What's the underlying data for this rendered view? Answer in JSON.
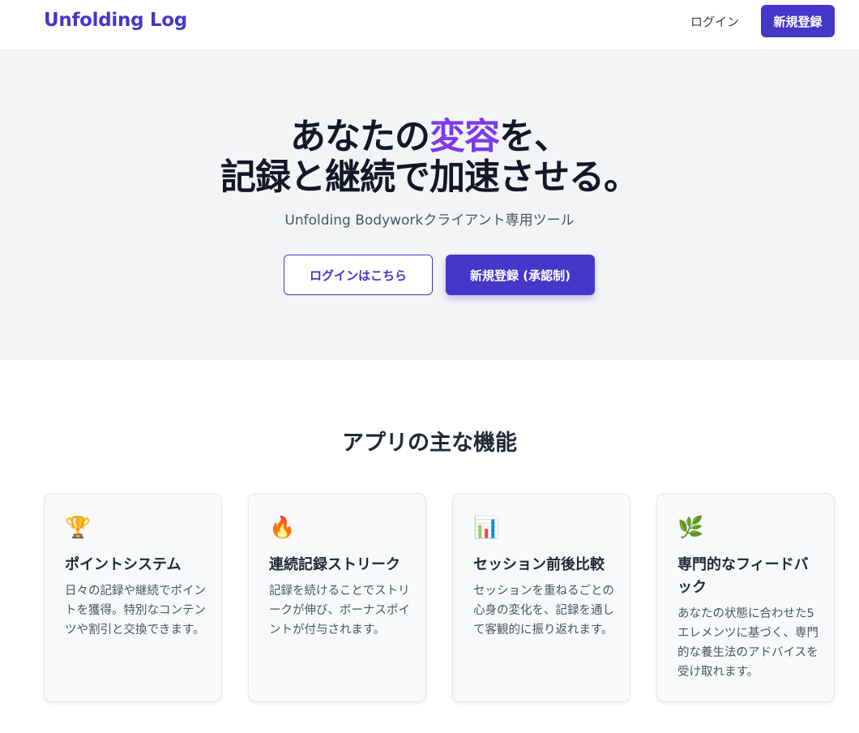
{
  "header": {
    "brand": "Unfolding Log",
    "login_label": "ログイン",
    "signup_label": "新規登録"
  },
  "hero": {
    "title_line1_pre": "あなたの",
    "title_line1_accent": "変容",
    "title_line1_post": "を、",
    "title_line2": "記録と継続で加速させる。",
    "subtitle": "Unfolding Bodyworkクライアント専用ツール",
    "login_button": "ログインはこちら",
    "signup_button": "新規登録 (承認制)"
  },
  "features": {
    "heading": "アプリの主な機能",
    "items": [
      {
        "icon": "trophy-icon",
        "glyph": "🏆",
        "title": "ポイントシステム",
        "description": "日々の記録や継続でポイントを獲得。特別なコンテンツや割引と交換できます。"
      },
      {
        "icon": "fire-icon",
        "glyph": "🔥",
        "title": "連続記録ストリーク",
        "description": "記録を続けることでストリークが伸び、ボーナスポイントが付与されます。"
      },
      {
        "icon": "bar-chart-icon",
        "glyph": "📊",
        "title": "セッション前後比較",
        "description": "セッションを重ねるごとの心身の変化を、記録を通して客観的に振り返れます。"
      },
      {
        "icon": "herb-icon",
        "glyph": "🌿",
        "title": "専門的なフィードバック",
        "description": "あなたの状態に合わせた5エレメンツに基づく、専門的な養生法のアドバイスを受け取れます。"
      }
    ]
  },
  "colors": {
    "brand": "#4338ca",
    "accent": "#7c3aed"
  }
}
